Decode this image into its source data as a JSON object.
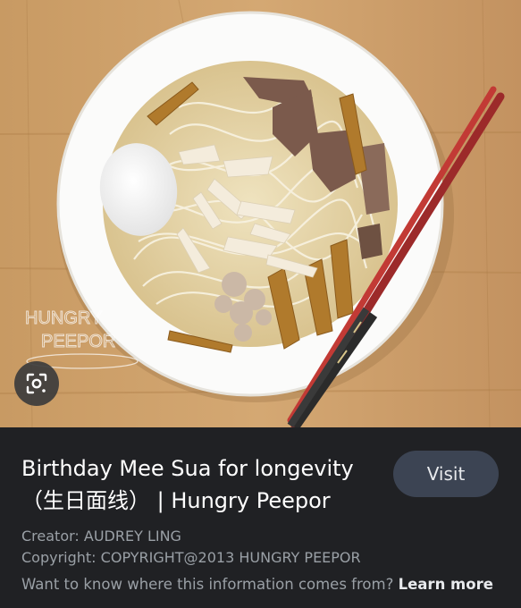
{
  "image": {
    "description_icon": "noodle-soup-photo",
    "watermark_line1": "HUNGRY",
    "watermark_line2": "PEEPOR"
  },
  "lens_button": {
    "icon": "lens-icon"
  },
  "info": {
    "title_line1": "Birthday Mee Sua for longevity",
    "title_line2": "（生日面线） | Hungry Peepor",
    "visit_label": "Visit",
    "creator_label": "Creator:",
    "creator_value": "AUDREY LING",
    "copyright_label": "Copyright:",
    "copyright_value": "COPYRIGHT@2013 HUNGRY PEEPOR",
    "question": "Want to know where this information comes from?",
    "learn_more": "Learn more"
  },
  "colors": {
    "panel_bg": "#202124",
    "visit_bg": "#3c4453",
    "secondary_text": "#9aa0a6"
  }
}
